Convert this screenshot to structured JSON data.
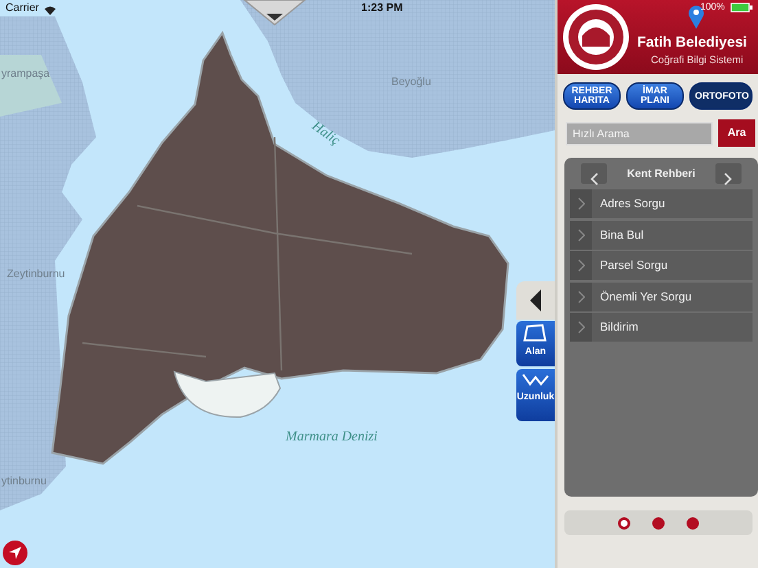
{
  "status_bar": {
    "carrier": "Carrier",
    "time": "1:23 PM",
    "battery": "100%"
  },
  "map": {
    "labels": [
      {
        "text": "yrampaşa",
        "kind": "district"
      },
      {
        "text": "Beyoğlu",
        "kind": "district"
      },
      {
        "text": "Haliç",
        "kind": "water"
      },
      {
        "text": "Zeytinburnu",
        "kind": "district"
      },
      {
        "text": "ytinburnu",
        "kind": "district"
      },
      {
        "text": "Marmara Denizi",
        "kind": "water"
      }
    ]
  },
  "header": {
    "title": "Fatih Belediyesi",
    "subtitle": "Coğrafi Bilgi Sistemi"
  },
  "layer_buttons": [
    {
      "label": "REHBER HARITA",
      "selected": false
    },
    {
      "label": "İMAR PLANI",
      "selected": false
    },
    {
      "label": "ORTOFOTO",
      "selected": true
    }
  ],
  "search": {
    "placeholder": "Hızlı Arama",
    "button": "Ara"
  },
  "panel": {
    "title": "Kent Rehberi",
    "items": [
      "Adres Sorgu",
      "Bina Bul",
      "Parsel Sorgu",
      "Önemli Yer Sorgu",
      "Bildirim"
    ]
  },
  "tools": [
    {
      "label": "Alan",
      "kind": "area"
    },
    {
      "label": "Uzunluk",
      "kind": "length"
    }
  ],
  "pages": [
    {
      "selected": true
    },
    {
      "selected": false
    },
    {
      "selected": false
    }
  ]
}
